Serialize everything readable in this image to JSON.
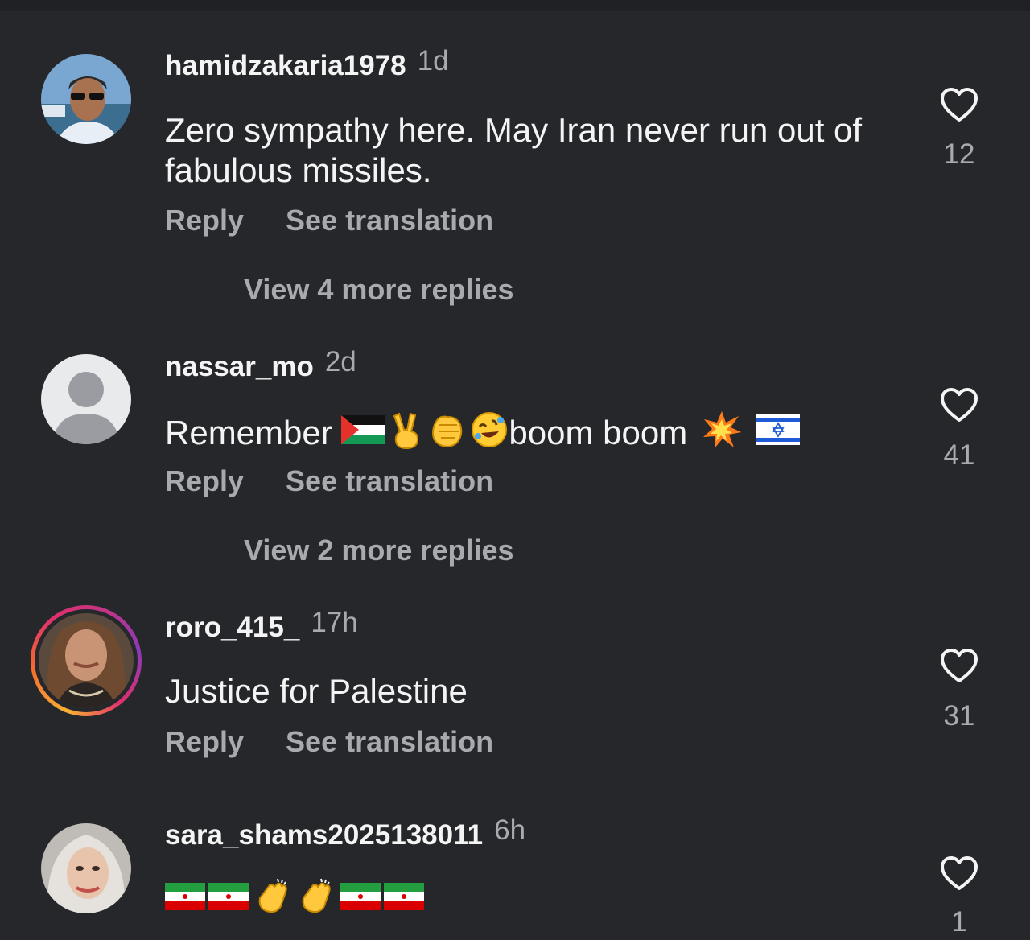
{
  "comments": [
    {
      "username": "hamidzakaria1978",
      "time": "1d",
      "text": "Zero sympathy here. May Iran never run out of fabulous missiles.",
      "reply_label": "Reply",
      "translate_label": "See translation",
      "more_replies": "View 4 more replies",
      "likes": "12"
    },
    {
      "username": "nassar_mo",
      "time": "2d",
      "text_start": "Remember",
      "text_mid": "boom boom",
      "emojis": [
        "palestine-flag-icon",
        "victory-hand-icon",
        "fist-bump-icon",
        "rolling-laughing-icon",
        "collision-icon",
        "israel-flag-icon"
      ],
      "reply_label": "Reply",
      "translate_label": "See translation",
      "more_replies": "View 2 more replies",
      "likes": "41"
    },
    {
      "username": "roro_415_",
      "time": "17h",
      "text": "Justice for Palestine",
      "reply_label": "Reply",
      "translate_label": "See translation",
      "likes": "31"
    },
    {
      "username": "sara_shams2025138011",
      "time": "6h",
      "emojis": [
        "iran-flag-icon",
        "iran-flag-icon",
        "clapping-hands-icon",
        "clapping-hands-icon",
        "iran-flag-icon",
        "iran-flag-icon"
      ],
      "likes": "1"
    }
  ],
  "colors": {
    "background": "#26272b",
    "primary_text": "#f4f4f4",
    "secondary_text": "#a9aaaf"
  }
}
